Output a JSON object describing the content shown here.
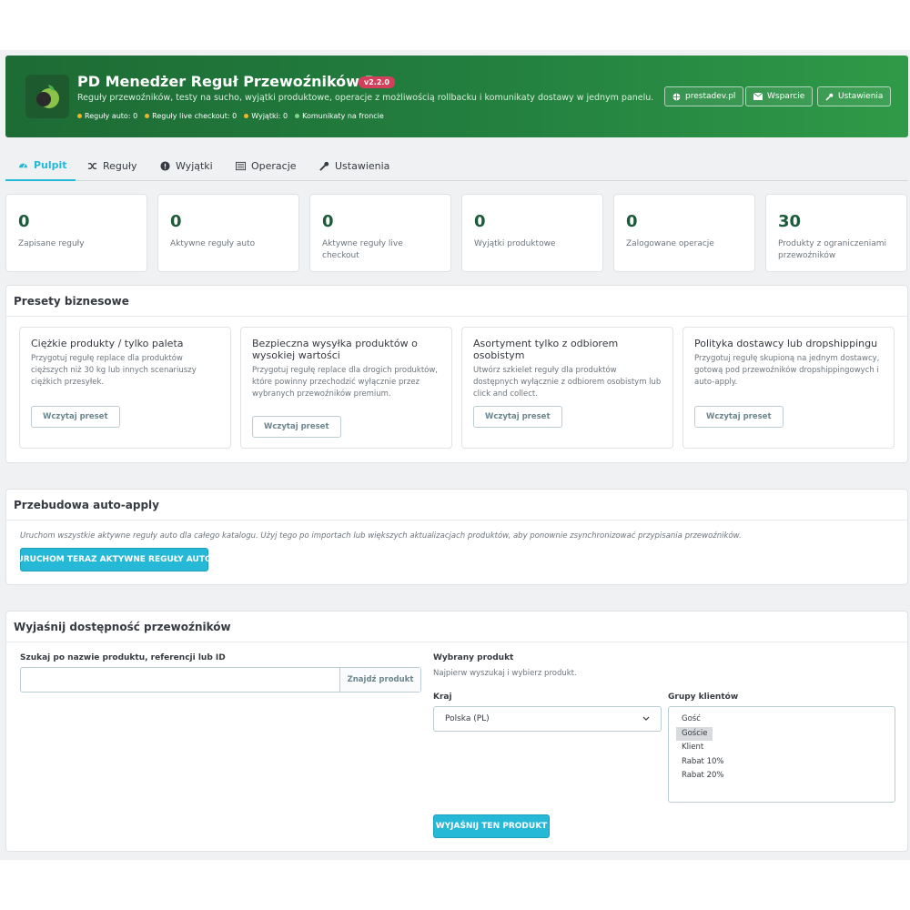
{
  "header": {
    "title": "PD Menedżer Reguł Przewoźników Pro",
    "version": "v2.2.0",
    "subtitle": "Reguły przewoźników, testy na sucho, wyjątki produktowe, operacje z możliwością rollbacku i komunikaty dostawy w jednym panelu.",
    "stats": [
      {
        "label": "Reguły auto: 0",
        "color": "#f0b429"
      },
      {
        "label": "Reguły live checkout: 0",
        "color": "#f0b429"
      },
      {
        "label": "Wyjątki: 0",
        "color": "#f0b429"
      },
      {
        "label": "Komunikaty na froncie",
        "color": "#7bd389"
      }
    ],
    "buttons": [
      {
        "label": "prestadev.pl",
        "icon": "globe-icon"
      },
      {
        "label": "Wsparcie",
        "icon": "envelope-icon"
      },
      {
        "label": "Ustawienia",
        "icon": "wrench-icon"
      }
    ]
  },
  "tabs": [
    {
      "label": "Pulpit",
      "icon": "dashboard-icon",
      "active": true
    },
    {
      "label": "Reguły",
      "icon": "shuffle-icon"
    },
    {
      "label": "Wyjątki",
      "icon": "info-circle-icon"
    },
    {
      "label": "Operacje",
      "icon": "list-icon"
    },
    {
      "label": "Ustawienia",
      "icon": "wrench-icon"
    }
  ],
  "stat_cards": [
    {
      "value": "0",
      "label": "Zapisane reguły"
    },
    {
      "value": "0",
      "label": "Aktywne reguły auto"
    },
    {
      "value": "0",
      "label": "Aktywne reguły live checkout"
    },
    {
      "value": "0",
      "label": "Wyjątki produktowe"
    },
    {
      "value": "0",
      "label": "Zalogowane operacje"
    },
    {
      "value": "30",
      "label": "Produkty z ograniczeniami przewoźników"
    }
  ],
  "presets": {
    "title": "Presety biznesowe",
    "button_label": "Wczytaj preset",
    "items": [
      {
        "title": "Ciężkie produkty / tylko paleta",
        "desc": "Przygotuj regułę replace dla produktów cięższych niż 30 kg lub innych scenariuszy ciężkich przesyłek."
      },
      {
        "title": "Bezpieczna wysyłka produktów o wysokiej wartości",
        "desc": "Przygotuj regułę replace dla drogich produktów, które powinny przechodzić wyłącznie przez wybranych przewoźników premium."
      },
      {
        "title": "Asortyment tylko z odbiorem osobistym",
        "desc": "Utwórz szkielet reguły dla produktów dostępnych wyłącznie z odbiorem osobistym lub click and collect."
      },
      {
        "title": "Polityka dostawcy lub dropshippingu",
        "desc": "Przygotuj regułę skupioną na jednym dostawcy, gotową pod przewoźników dropshippingowych i auto-apply."
      }
    ]
  },
  "rebuild": {
    "title": "Przebudowa auto-apply",
    "desc": "Uruchom wszystkie aktywne reguły auto dla całego katalogu. Użyj tego po importach lub większych aktualizacjach produktów, aby ponownie zsynchronizować przypisania przewoźników.",
    "button": "URUCHOM TERAZ AKTYWNE REGUŁY AUTO"
  },
  "explain": {
    "title": "Wyjaśnij dostępność przewoźników",
    "search_label": "Szukaj po nazwie produktu, referencji lub ID",
    "search_value": "",
    "search_button": "Znajdź produkt",
    "selected_label": "Wybrany produkt",
    "selected_hint": "Najpierw wyszukaj i wybierz produkt.",
    "country_label": "Kraj",
    "country_value": "Polska (PL)",
    "groups_label": "Grupy klientów",
    "groups": [
      "Gość",
      "Goście",
      "Klient",
      "Rabat 10%",
      "Rabat 20%"
    ],
    "groups_selected": "Goście",
    "explain_button": "WYJAŚNIJ TEN PRODUKT"
  }
}
